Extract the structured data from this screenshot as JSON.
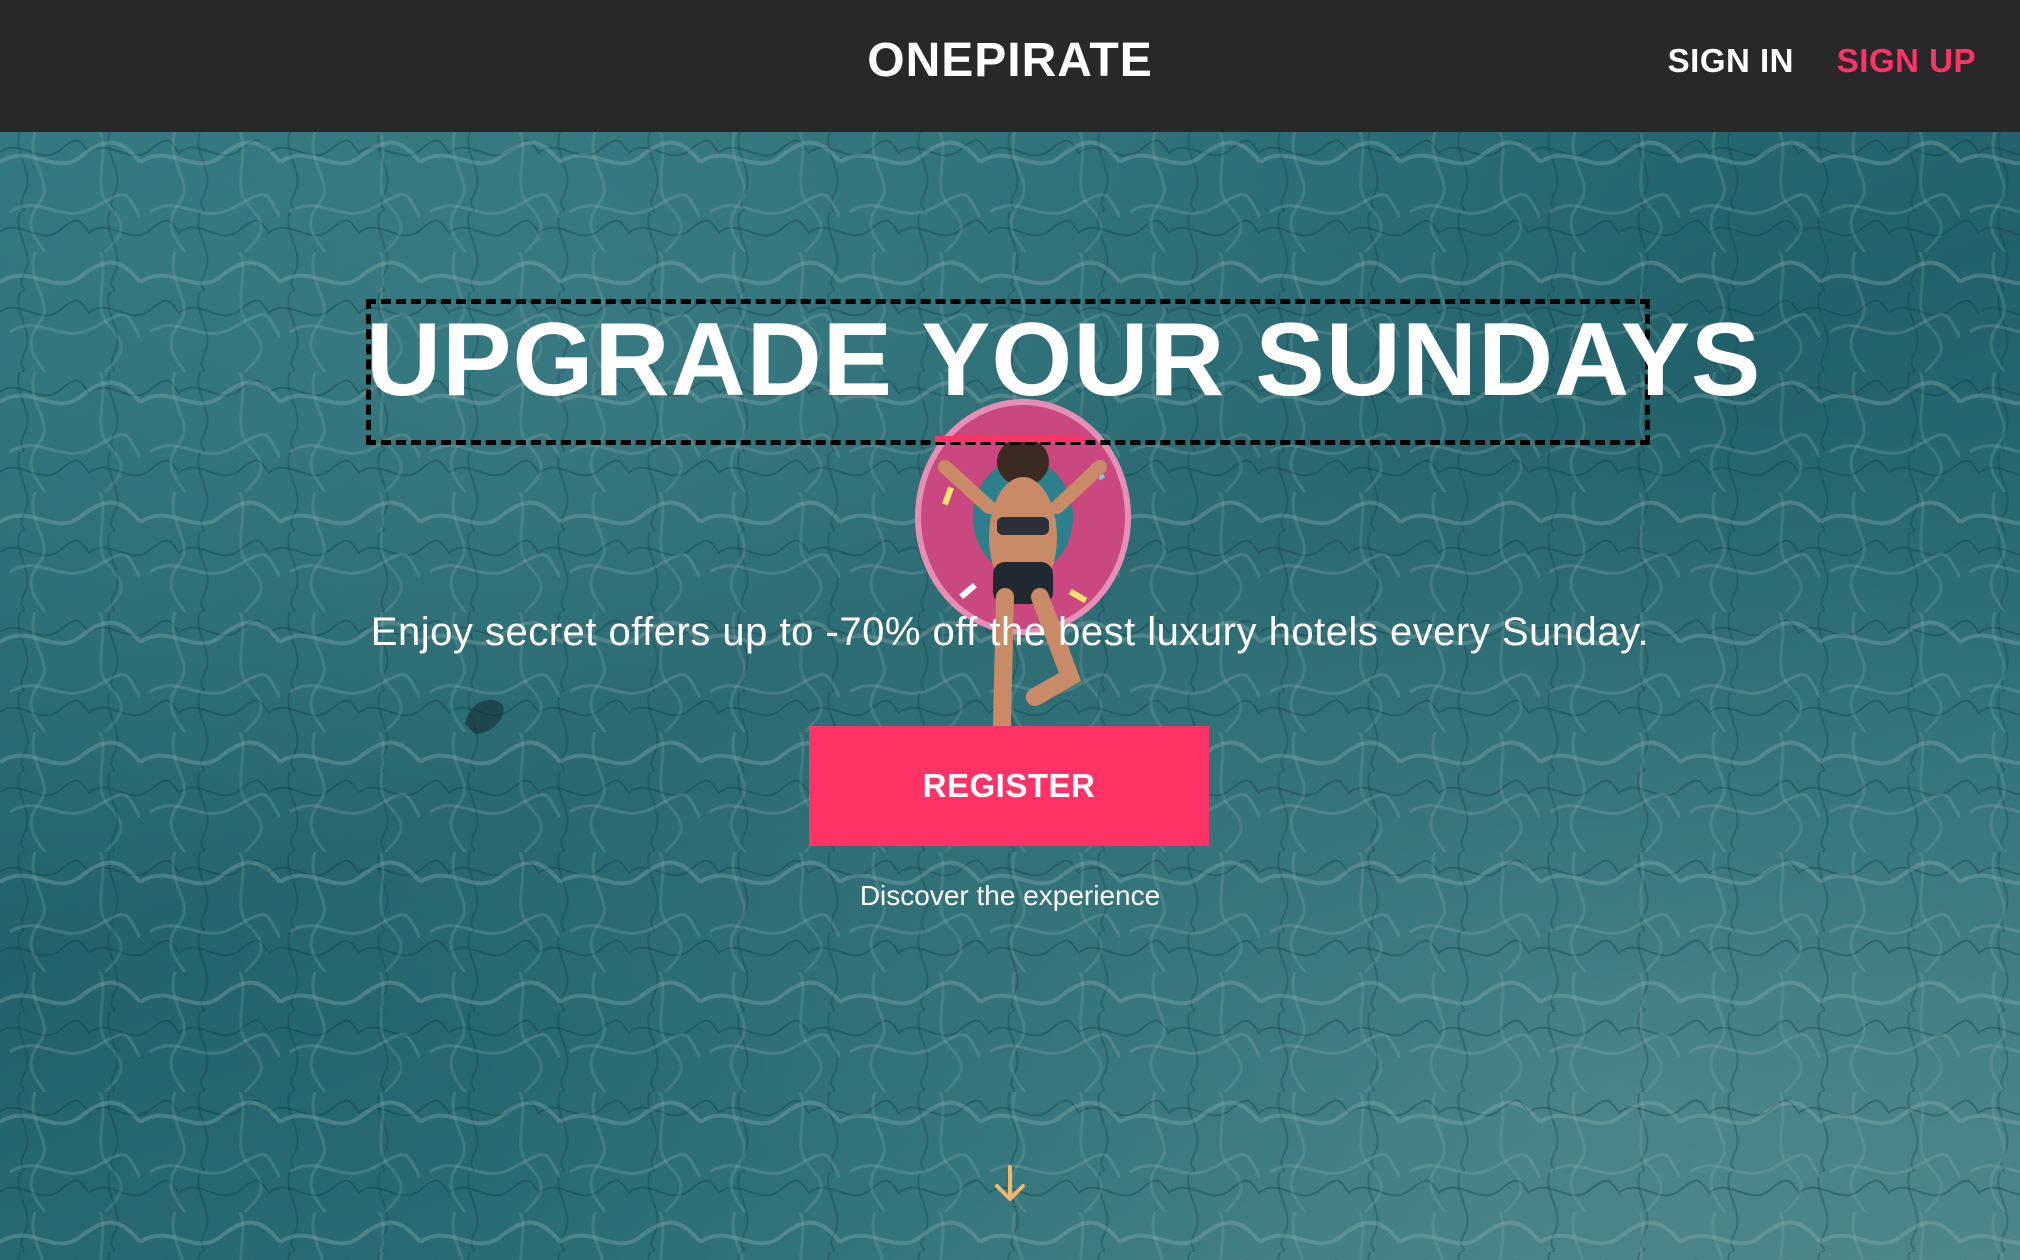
{
  "app": {
    "brand": "ONEPIRATE"
  },
  "nav": {
    "sign_in": "SIGN IN",
    "sign_up": "SIGN UP"
  },
  "hero": {
    "title": "UPGRADE YOUR SUNDAYS",
    "subtitle": "Enjoy secret offers up to -70% off the best luxury hotels every Sunday.",
    "cta_label": "REGISTER",
    "secondary_text": "Discover the experience",
    "scroll_icon": "arrow-down-icon"
  },
  "colors": {
    "accent": "#ff3366",
    "topbar_bg": "#28282a",
    "text_light": "#ffffff",
    "scroll_arrow": "#f2b66d"
  }
}
